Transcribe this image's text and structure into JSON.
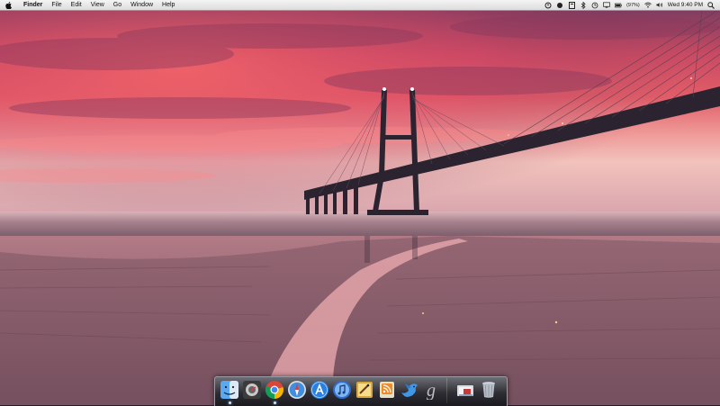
{
  "menubar": {
    "app_name": "Finder",
    "menus": [
      "File",
      "Edit",
      "View",
      "Go",
      "Window",
      "Help"
    ],
    "status_icons": [
      "spotlight-helper-icon",
      "record-icon",
      "notification-icon",
      "bluetooth-icon",
      "time-machine-icon",
      "display-icon",
      "battery-icon",
      "wifi-icon",
      "volume-icon"
    ],
    "battery_percent": "(97%)",
    "clock": "Wed 9:40 PM",
    "spotlight_icon": "search-icon"
  },
  "dock": {
    "items": [
      {
        "name": "finder-icon",
        "running": true
      },
      {
        "name": "dashboard-icon",
        "running": false
      },
      {
        "name": "chrome-icon",
        "running": true
      },
      {
        "name": "safari-icon",
        "running": false
      },
      {
        "name": "app-store-icon",
        "running": false
      },
      {
        "name": "itunes-icon",
        "running": false
      },
      {
        "name": "scripteditor-icon",
        "running": false
      },
      {
        "name": "rss-reader-icon",
        "running": false
      },
      {
        "name": "twitter-bird-icon",
        "running": false
      },
      {
        "name": "g-app-icon",
        "running": false
      },
      {
        "name": "documents-folder-icon",
        "running": false
      },
      {
        "name": "trash-icon",
        "running": false
      }
    ]
  },
  "colors": {
    "sky_top": "#7d3f63",
    "sky_glow": "#e8595f",
    "horizon": "#f0b9b3",
    "water": "#b88a94",
    "bridge": "#2b2430"
  }
}
